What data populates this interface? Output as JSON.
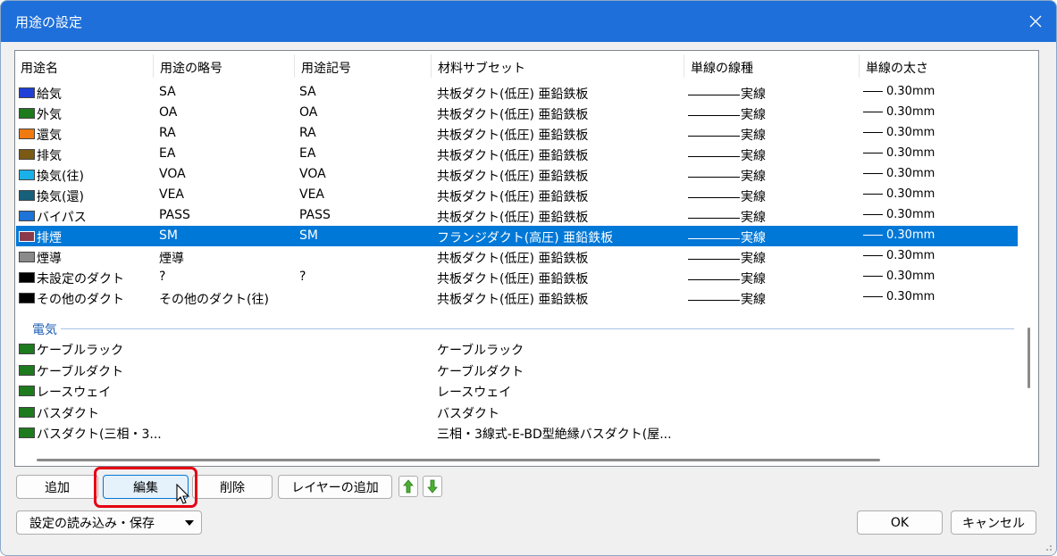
{
  "window": {
    "title": "用途の設定"
  },
  "columns": [
    "用途名",
    "用途の略号",
    "用途記号",
    "材料サブセット",
    "単線の線種",
    "単線の太さ"
  ],
  "rows": [
    {
      "name": "給気",
      "abbr": "SA",
      "symbol": "SA",
      "material": "共板ダクト(低圧) 亜鉛鉄板",
      "linetype": "実線",
      "width": "0.30mm",
      "color": "#1f3fd6"
    },
    {
      "name": "外気",
      "abbr": "OA",
      "symbol": "OA",
      "material": "共板ダクト(低圧) 亜鉛鉄板",
      "linetype": "実線",
      "width": "0.30mm",
      "color": "#1d7a1d"
    },
    {
      "name": "還気",
      "abbr": "RA",
      "symbol": "RA",
      "material": "共板ダクト(低圧) 亜鉛鉄板",
      "linetype": "実線",
      "width": "0.30mm",
      "color": "#f07a10"
    },
    {
      "name": "排気",
      "abbr": "EA",
      "symbol": "EA",
      "material": "共板ダクト(低圧) 亜鉛鉄板",
      "linetype": "実線",
      "width": "0.30mm",
      "color": "#7a5a14"
    },
    {
      "name": "換気(往)",
      "abbr": "VOA",
      "symbol": "VOA",
      "material": "共板ダクト(低圧) 亜鉛鉄板",
      "linetype": "実線",
      "width": "0.30mm",
      "color": "#1ab0e8"
    },
    {
      "name": "換気(還)",
      "abbr": "VEA",
      "symbol": "VEA",
      "material": "共板ダクト(低圧) 亜鉛鉄板",
      "linetype": "実線",
      "width": "0.30mm",
      "color": "#15607a"
    },
    {
      "name": "バイパス",
      "abbr": "PASS",
      "symbol": "PASS",
      "material": "共板ダクト(低圧) 亜鉛鉄板",
      "linetype": "実線",
      "width": "0.30mm",
      "color": "#1e73d6"
    },
    {
      "name": "排煙",
      "abbr": "SM",
      "symbol": "SM",
      "material": "フランジダクト(高圧) 亜鉛鉄板",
      "linetype": "実線",
      "width": "0.30mm",
      "color": "#8a3a4a",
      "selected": true
    },
    {
      "name": "煙導",
      "abbr": "煙導",
      "symbol": "",
      "material": "共板ダクト(低圧) 亜鉛鉄板",
      "linetype": "実線",
      "width": "0.30mm",
      "color": "#8a8a8a"
    },
    {
      "name": "未設定のダクト",
      "abbr": "?",
      "symbol": "?",
      "material": "共板ダクト(低圧) 亜鉛鉄板",
      "linetype": "実線",
      "width": "0.30mm",
      "color": "#000000"
    },
    {
      "name": "その他のダクト",
      "abbr": "その他のダクト(往)",
      "symbol": "",
      "material": "共板ダクト(低圧) 亜鉛鉄板",
      "linetype": "実線",
      "width": "0.30mm",
      "color": "#000000"
    }
  ],
  "group": {
    "label": "電気"
  },
  "elec_rows": [
    {
      "name": "ケーブルラック",
      "material": "ケーブルラック",
      "color": "#1d7a1d"
    },
    {
      "name": "ケーブルダクト",
      "material": "ケーブルダクト",
      "color": "#1d7a1d"
    },
    {
      "name": "レースウェイ",
      "material": "レースウェイ",
      "color": "#1d7a1d"
    },
    {
      "name": "バスダクト",
      "material": "バスダクト",
      "color": "#1d7a1d"
    },
    {
      "name": "バスダクト(三相・3...",
      "material": "三相・3線式-E-BD型絶縁バスダクト(屋...",
      "color": "#1d7a1d"
    }
  ],
  "buttons": {
    "add": "追加",
    "edit": "編集",
    "delete": "削除",
    "add_layer": "レイヤーの追加",
    "load_save": "設定の読み込み・保存",
    "ok": "OK",
    "cancel": "キャンセル"
  },
  "colors": {
    "accent": "#0078d7",
    "titlebar": "#1e6fd9",
    "highlight": "#e60012"
  }
}
